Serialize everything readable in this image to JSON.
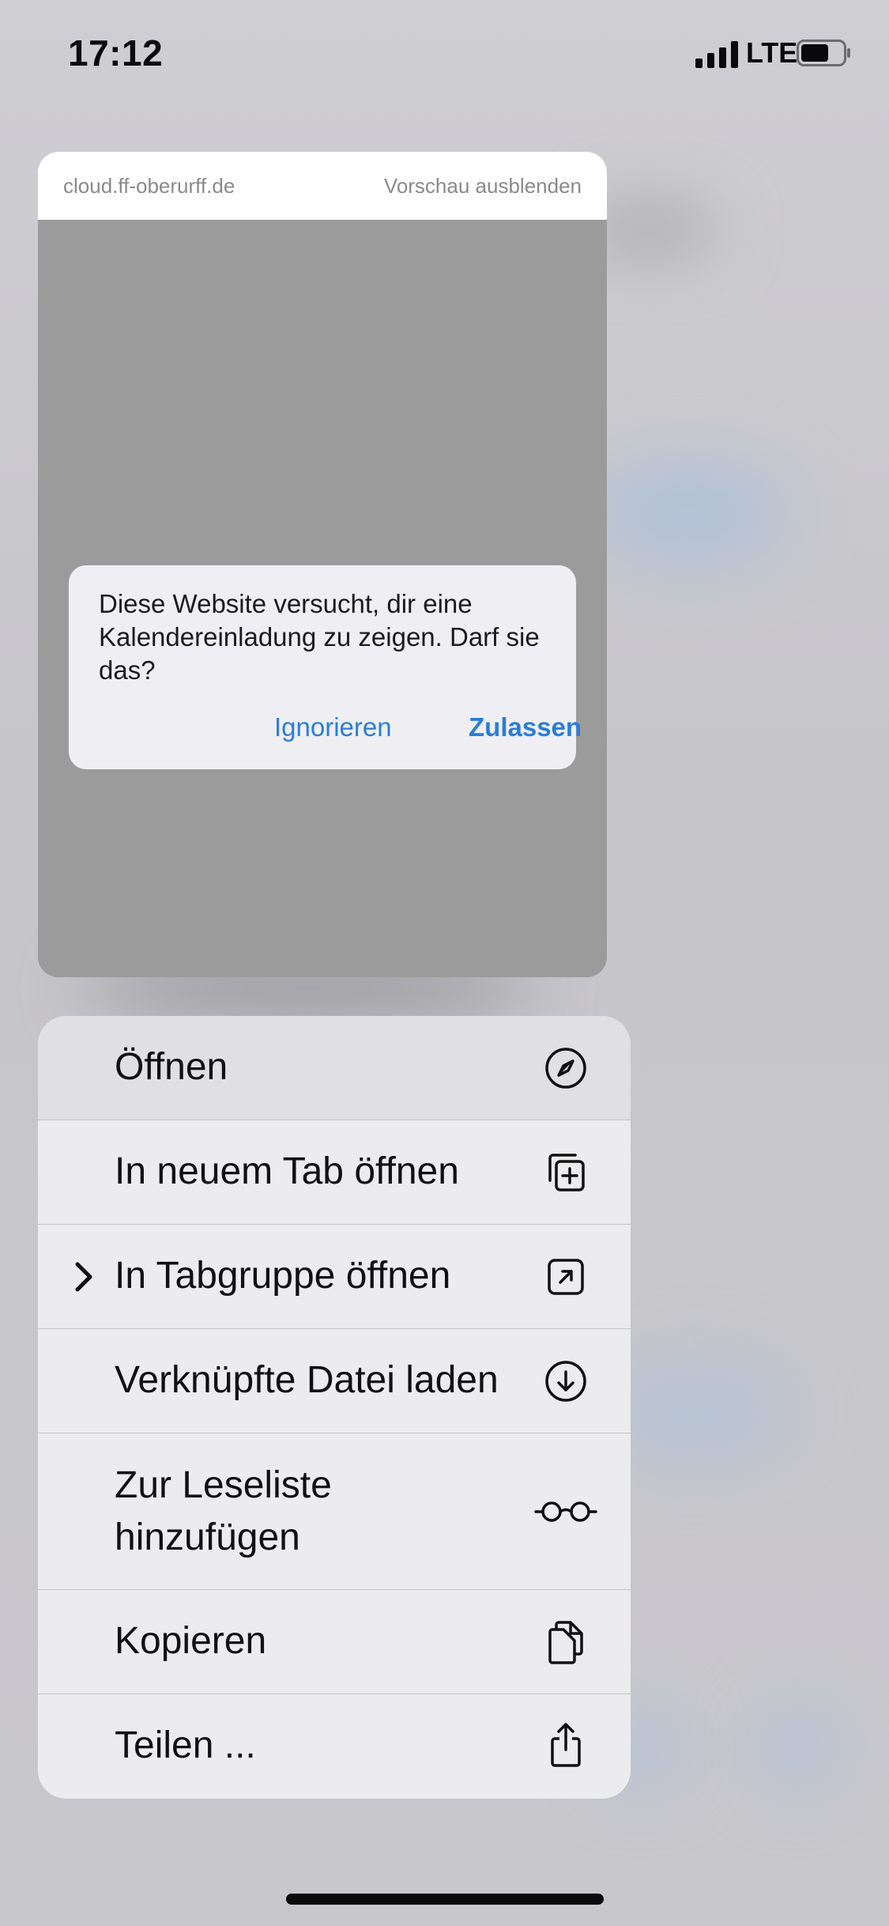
{
  "status": {
    "time": "17:12",
    "network": "LTE"
  },
  "preview": {
    "url": "cloud.ff-oberurff.de",
    "hide_label": "Vorschau ausblenden",
    "alert": {
      "message": "Diese Website versucht, dir eine Kalendereinladung zu zeigen. Darf sie das?",
      "ignore_label": "Ignorieren",
      "allow_label": "Zulassen"
    }
  },
  "menu": {
    "items": [
      {
        "label": "Öffnen",
        "icon": "compass-icon"
      },
      {
        "label": "In neuem Tab öffnen",
        "icon": "new-tab-icon"
      },
      {
        "label": "In Tabgruppe öffnen",
        "icon": "open-in-group-icon",
        "has_submenu": true
      },
      {
        "label": "Verknüpfte Datei laden",
        "icon": "download-icon"
      },
      {
        "label_line1": "Zur Leseliste",
        "label_line2": "hinzufügen",
        "icon": "glasses-icon"
      },
      {
        "label": "Kopieren",
        "icon": "copy-icon"
      },
      {
        "label": "Teilen ...",
        "icon": "share-icon"
      }
    ]
  },
  "colors": {
    "link": "#2a7dd6",
    "menu_bg": "#ececee",
    "preview_bg": "#9b9b9b"
  }
}
